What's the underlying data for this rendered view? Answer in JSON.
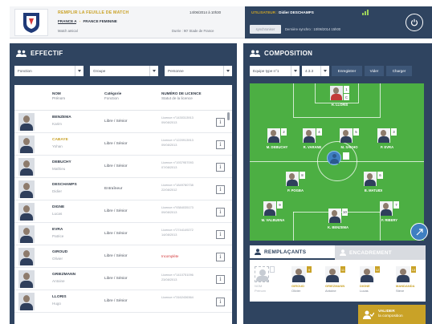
{
  "header": {
    "title": "REMPLIR LA FEUILLE DE MATCH",
    "datetime": "14/06/2014 à 10h30",
    "team_home": "FRANCE A",
    "vs": "-",
    "team_away": "FRANCE FEMININE",
    "match_type": "Match amical",
    "venue": "Durée : 90'    Stade de France",
    "user_label": "UTILISATEUR :",
    "user_name": "Didier DESCHAMPS",
    "sync_button": "synchroniser",
    "last_sync": "Dernière synchro : 10/06/2014    15h00"
  },
  "effectif": {
    "title": "EFFECTIF",
    "filters": [
      "Fonction",
      "Groupe",
      "Personne"
    ],
    "columns": {
      "name": "NOM",
      "name_sub": "Prénom",
      "cat": "Catégorie",
      "cat_sub": "Fonction",
      "lic": "NUMÉRO DE LICENCE",
      "lic_sub": "Statut de la licence"
    },
    "players": [
      {
        "last": "BENZEMA",
        "first": "Karim",
        "category": "Libre / Sénior",
        "license": "Licence n°1430313913",
        "license_date": "09/08/2013",
        "highlight": false
      },
      {
        "last": "CABAYE",
        "first": "Yohan",
        "category": "Libre / Sénior",
        "license": "Licence n°1220913913",
        "license_date": "09/08/2013",
        "highlight": true
      },
      {
        "last": "DEBUCHY",
        "first": "Mathieu",
        "category": "Libre / Sénior",
        "license": "Licence n°1937957093",
        "license_date": "07/08/2013",
        "highlight": false
      },
      {
        "last": "DESCHAMPS",
        "first": "Didier",
        "category": "Entraîneur",
        "license": "Licence n°1849780738",
        "license_date": "22/08/2012",
        "highlight": false
      },
      {
        "last": "DIGNE",
        "first": "Lucas",
        "category": "Libre / Sénior",
        "license": "Licence n°9384035173",
        "license_date": "09/08/2013",
        "highlight": false
      },
      {
        "last": "EVRA",
        "first": "Patrice",
        "category": "Libre / Sénior",
        "license": "Licence n°2744149272",
        "license_date": "14/08/2013",
        "highlight": false
      },
      {
        "last": "GIROUD",
        "first": "Olivier",
        "category": "Libre / Sénior",
        "license": "Incomplète",
        "license_date": "",
        "highlight": false
      },
      {
        "last": "GRIEZMANN",
        "first": "Antoine",
        "category": "Libre / Sénior",
        "license": "Licence n°1410751096",
        "license_date": "23/08/2013",
        "highlight": false
      },
      {
        "last": "LLORIS",
        "first": "Hugo",
        "category": "Libre / Sénior",
        "license": "Licence n°3162436364",
        "license_date": "",
        "highlight": false
      }
    ],
    "info_icon_label": "i"
  },
  "composition": {
    "title": "COMPOSITION",
    "team_select": "Equipe type n°1",
    "formation_select": "4.3.3",
    "save_button": "Enregistrer",
    "clear_button": "Vider",
    "load_button": "Charger",
    "pitch_players": [
      {
        "num": "1",
        "cap": "C",
        "name": "H. LLORIS",
        "gk": true
      },
      {
        "num": "2",
        "name": "M. DEBUCHY"
      },
      {
        "num": "4",
        "name": "R. VARANE"
      },
      {
        "num": "5",
        "name": "M. SAKHO"
      },
      {
        "num": "3",
        "name": "P. EVRA"
      },
      {
        "num": "8",
        "name": "P. POGBA"
      },
      {
        "num": "6",
        "name": "B. MATUIDI"
      },
      {
        "num": "9",
        "name": "M. VALBUENA"
      },
      {
        "num": "10",
        "name": "K. BENZEMA"
      },
      {
        "num": "7",
        "name": "F. RIBERY"
      }
    ],
    "coach_num": "",
    "bench_tab": "REMPLAÇANTS",
    "staff_tab": "ENCADREMENT",
    "bench": [
      {
        "num": "",
        "last": "NOM",
        "first": "Prénom",
        "empty": true
      },
      {
        "num": "9",
        "last": "GIROUD",
        "first": "Olivier"
      },
      {
        "num": "11",
        "last": "GRIEZMANN",
        "first": "Antoine"
      },
      {
        "num": "12",
        "last": "DIGNE",
        "first": "Lucas"
      },
      {
        "num": "13",
        "last": "MANDANDA",
        "first": "Steve"
      }
    ],
    "validate_title": "VALIDER",
    "validate_sub": "la composition"
  },
  "colors": {
    "navy": "#2f4460",
    "gold": "#c9a227",
    "pitch": "#4caf43",
    "alert": "#d4393b"
  }
}
